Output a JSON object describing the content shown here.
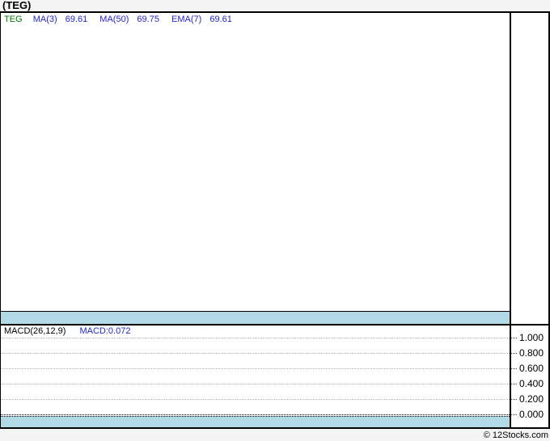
{
  "header": {
    "title": "(TEG)"
  },
  "price_panel": {
    "symbol": "TEG",
    "indicators": [
      {
        "label": "MA(3)",
        "value": "69.61"
      },
      {
        "label": "MA(50)",
        "value": "69.75"
      },
      {
        "label": "EMA(7)",
        "value": "69.61"
      }
    ]
  },
  "macd_panel": {
    "legend_label": "MACD(26,12,9)",
    "legend_value": "MACD:0.072",
    "yticks": [
      "1.000",
      "0.800",
      "0.600",
      "0.400",
      "0.200",
      "0.000"
    ]
  },
  "footer": {
    "credit": "© 12Stocks.com"
  },
  "colors": {
    "indicator_blue": "#2424cc",
    "symbol_green": "#007700",
    "axis_band_blue": "#b2d9e6",
    "gridline_gray": "#b3b3b3",
    "border_black": "#000000",
    "page_gray": "#f4f4f4"
  },
  "chart_data": [
    {
      "type": "line",
      "title": "(TEG) price panel",
      "series": [
        {
          "name": "MA(3)",
          "last_value": 69.61,
          "values": []
        },
        {
          "name": "MA(50)",
          "last_value": 69.75,
          "values": []
        },
        {
          "name": "EMA(7)",
          "last_value": 69.61,
          "values": []
        }
      ],
      "legend_position": "top-left",
      "note": "plot area is blank in screenshot; only legend values are shown"
    },
    {
      "type": "line",
      "title": "MACD(26,12,9)",
      "series": [
        {
          "name": "MACD",
          "last_value": 0.072,
          "values": []
        }
      ],
      "ylim": [
        0.0,
        1.0
      ],
      "yticks": [
        1.0,
        0.8,
        0.6,
        0.4,
        0.2,
        0.0
      ],
      "grid": "horizontal dotted",
      "legend_position": "top-left",
      "note": "plot area is blank in screenshot; zero line drawn bold dotted above light-blue axis band"
    }
  ]
}
